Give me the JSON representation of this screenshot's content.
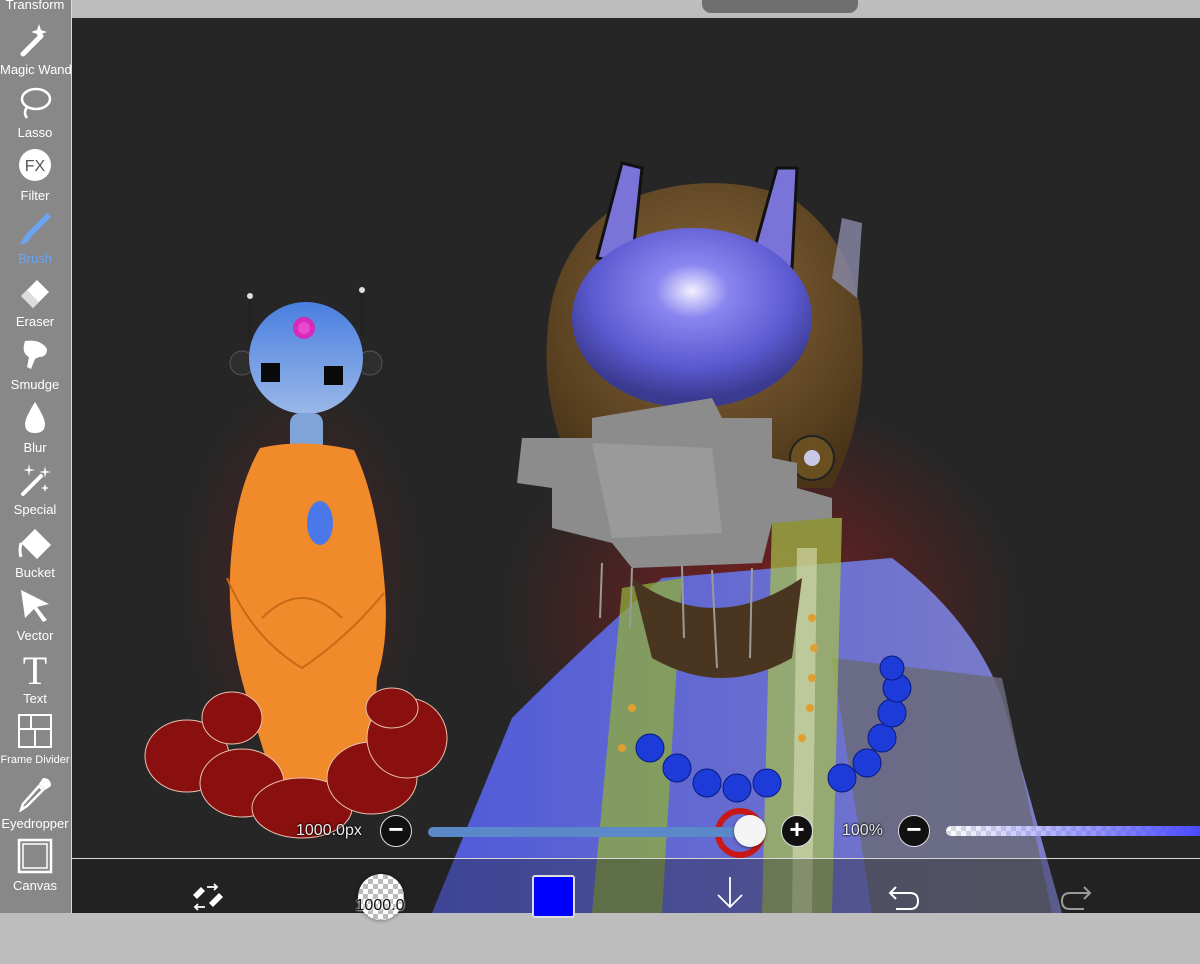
{
  "sidebar": {
    "transform_label": "Transform",
    "tools": [
      {
        "label": "Magic Wand",
        "icon": "magic-wand-icon"
      },
      {
        "label": "Lasso",
        "icon": "lasso-icon"
      },
      {
        "label": "Filter",
        "icon": "fx-filter-icon",
        "icon_text": "FX"
      },
      {
        "label": "Brush",
        "icon": "brush-icon",
        "active": true
      },
      {
        "label": "Eraser",
        "icon": "eraser-icon"
      },
      {
        "label": "Smudge",
        "icon": "smudge-icon"
      },
      {
        "label": "Blur",
        "icon": "blur-drop-icon"
      },
      {
        "label": "Special",
        "icon": "special-sparkle-icon"
      },
      {
        "label": "Bucket",
        "icon": "bucket-icon"
      },
      {
        "label": "Vector",
        "icon": "vector-arrow-icon"
      },
      {
        "label": "Text",
        "icon": "text-icon",
        "icon_text": "T"
      },
      {
        "label": "Frame Divider",
        "icon": "frame-divider-icon"
      },
      {
        "label": "Eyedropper",
        "icon": "eyedropper-icon"
      },
      {
        "label": "Canvas",
        "icon": "canvas-icon"
      }
    ],
    "active_color": "#6aa4f2"
  },
  "brush_bar": {
    "size_label": "1000.0px",
    "size_value": 1000.0,
    "size_fraction": 0.97,
    "minus": "−",
    "plus": "+",
    "opacity_label": "100%",
    "opacity_value": 100
  },
  "bottom_toolbar": {
    "brush_size_text": "1000.0",
    "current_color": "#0000ff",
    "icons": [
      "swap-tools-icon",
      "brush-preview",
      "color-swatch",
      "download-arrow-icon",
      "undo-icon",
      "redo-icon"
    ]
  }
}
